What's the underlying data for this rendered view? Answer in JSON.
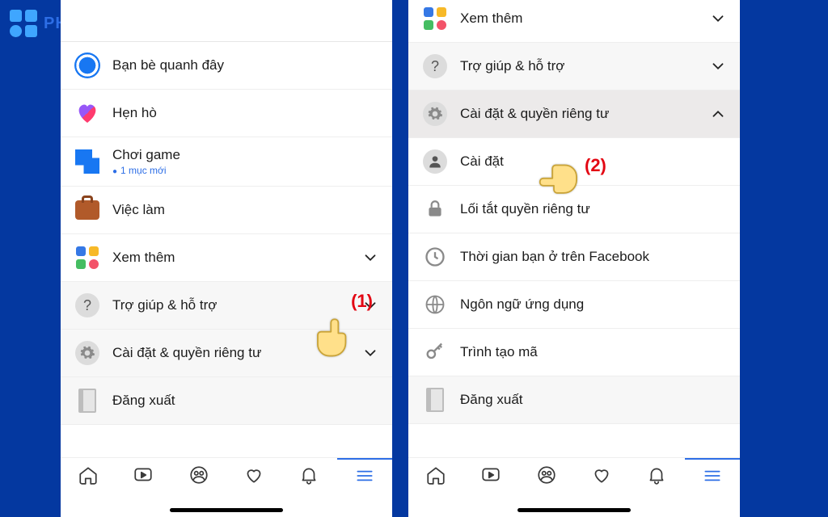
{
  "brand": {
    "name": "PHONG VU"
  },
  "callouts": {
    "one": "(1)",
    "two": "(2)"
  },
  "panel_left": {
    "items": [
      {
        "id": "friends-nearby",
        "label": "Bạn bè quanh đây",
        "icon": "friends"
      },
      {
        "id": "dating",
        "label": "Hẹn hò",
        "icon": "heart"
      },
      {
        "id": "gaming",
        "label": "Chơi game",
        "sub": "1 mục mới",
        "icon": "game"
      },
      {
        "id": "jobs",
        "label": "Việc làm",
        "icon": "briefcase"
      },
      {
        "id": "see-more",
        "label": "Xem thêm",
        "icon": "tiles",
        "chevron": "down"
      },
      {
        "id": "help",
        "label": "Trợ giúp & hỗ trợ",
        "icon": "question",
        "chevron": "down",
        "section": true
      },
      {
        "id": "settings-privacy",
        "label": "Cài đặt & quyền riêng tư",
        "icon": "gear",
        "chevron": "down",
        "section": true
      },
      {
        "id": "logout",
        "label": "Đăng xuất",
        "icon": "door",
        "section": true
      }
    ]
  },
  "panel_right": {
    "items": [
      {
        "id": "see-more",
        "label": "Xem thêm",
        "icon": "tiles",
        "chevron": "down"
      },
      {
        "id": "help",
        "label": "Trợ giúp & hỗ trợ",
        "icon": "question",
        "chevron": "down",
        "section": true
      },
      {
        "id": "settings-privacy",
        "label": "Cài đặt & quyền riêng tư",
        "icon": "gear",
        "chevron": "up",
        "section": true,
        "expanded": true
      },
      {
        "id": "settings",
        "label": "Cài đặt",
        "icon": "person",
        "indent": true
      },
      {
        "id": "privacy-shortcuts",
        "label": "Lối tắt quyền riêng tư",
        "icon": "lock",
        "indent": true
      },
      {
        "id": "your-time",
        "label": "Thời gian bạn ở trên Facebook",
        "icon": "clock",
        "indent": true
      },
      {
        "id": "app-language",
        "label": "Ngôn ngữ ứng dụng",
        "icon": "globe",
        "indent": true
      },
      {
        "id": "code-gen",
        "label": "Trình tạo mã",
        "icon": "key",
        "indent": true
      },
      {
        "id": "logout",
        "label": "Đăng xuất",
        "icon": "door",
        "section": true
      }
    ]
  },
  "nav": {
    "tabs": [
      "home",
      "watch",
      "groups",
      "dating",
      "notifications",
      "menu"
    ],
    "active": "menu"
  }
}
